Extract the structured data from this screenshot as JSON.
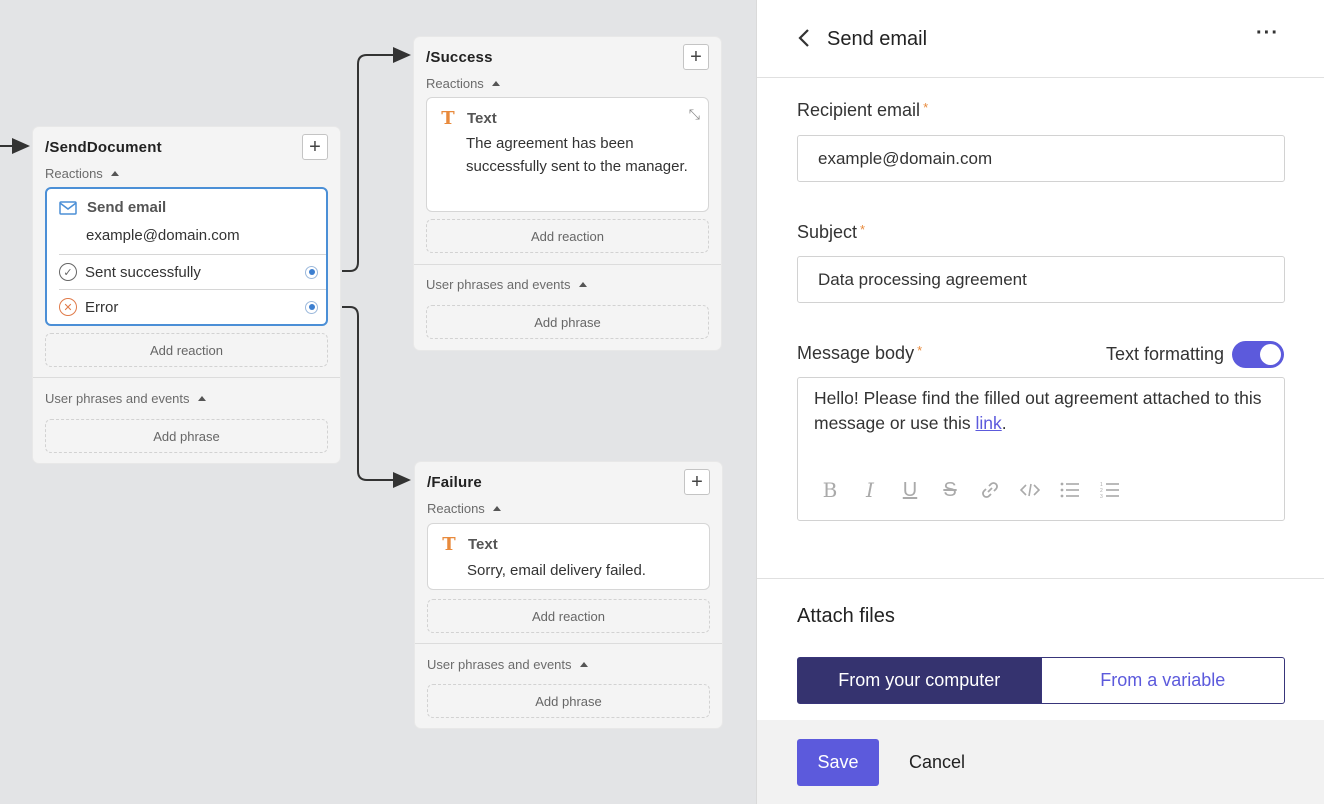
{
  "canvas": {
    "send_document": {
      "title": "/SendDocument",
      "reactions_label": "Reactions",
      "reaction": {
        "title": "Send email",
        "email": "example@domain.com",
        "results": [
          {
            "label": "Sent successfully",
            "icon": "check-circle-icon"
          },
          {
            "label": "Error",
            "icon": "error-circle-icon"
          }
        ]
      },
      "add_reaction": "Add reaction",
      "phrases_label": "User phrases and events",
      "add_phrase": "Add phrase"
    },
    "success": {
      "title": "/Success",
      "reactions_label": "Reactions",
      "reaction": {
        "title": "Text",
        "body": "The agreement has been successfully sent to the manager."
      },
      "add_reaction": "Add reaction",
      "phrases_label": "User phrases and events",
      "add_phrase": "Add phrase"
    },
    "failure": {
      "title": "/Failure",
      "reactions_label": "Reactions",
      "reaction": {
        "title": "Text",
        "body": "Sorry, email delivery failed."
      },
      "add_reaction": "Add reaction",
      "phrases_label": "User phrases and events",
      "add_phrase": "Add phrase"
    }
  },
  "panel": {
    "title": "Send email",
    "recipient_label": "Recipient email",
    "recipient_value": "example@domain.com",
    "subject_label": "Subject",
    "subject_value": "Data processing agreement",
    "body_label": "Message body",
    "text_formatting_label": "Text formatting",
    "text_formatting_on": true,
    "body_text_before": "Hello! Please find the filled out agreement attached to this message or use this ",
    "body_link": "link",
    "body_text_after": ".",
    "required_mark": "*",
    "attach_title": "Attach files",
    "attach_from_computer": "From your computer",
    "attach_from_variable": "From a variable",
    "save": "Save",
    "cancel": "Cancel"
  },
  "colors": {
    "accent": "#5c5adc",
    "accent_dark": "#35336f",
    "selected_border": "#4b8fd6",
    "warning": "#e88a3c"
  }
}
